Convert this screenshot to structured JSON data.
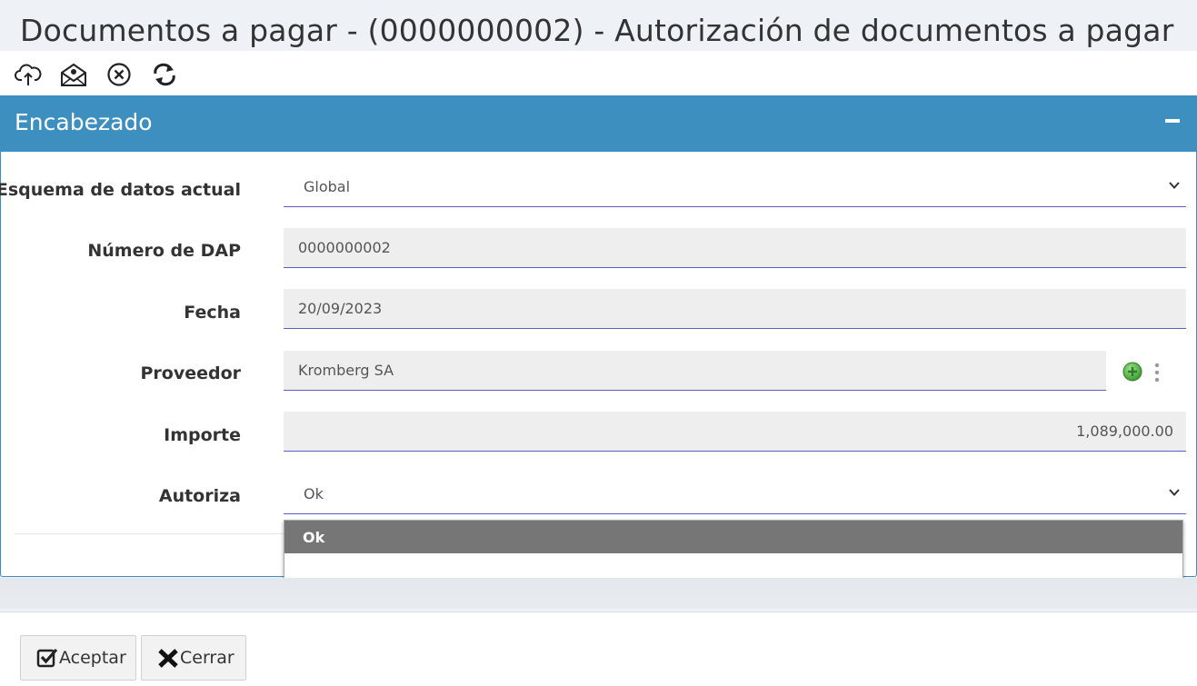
{
  "window": {
    "title": "Documentos a pagar - (0000000002) - Autorización de documentos a pagar"
  },
  "toolbar": {
    "icons": [
      "cloud-upload-icon",
      "open-envelope-icon",
      "circle-x-icon",
      "refresh-icon"
    ]
  },
  "panel": {
    "title": "Encabezado"
  },
  "form": {
    "schema": {
      "label": "Esquema de datos actual",
      "value": "Global"
    },
    "dap_number": {
      "label": "Número de DAP",
      "value": "0000000002"
    },
    "date": {
      "label": "Fecha",
      "value": "20/09/2023"
    },
    "supplier": {
      "label": "Proveedor",
      "value": "Kromberg SA"
    },
    "amount": {
      "label": "Importe",
      "value": "1,089,000.00"
    },
    "authorizes": {
      "label": "Autoriza",
      "value": "Ok",
      "options": [
        "Ok",
        ""
      ]
    }
  },
  "footer": {
    "accept_label": "Aceptar",
    "close_label": "Cerrar"
  },
  "colors": {
    "accent": "#3d8fc0",
    "field_underline": "#5a5fc0",
    "add_green": "#4caf50"
  }
}
